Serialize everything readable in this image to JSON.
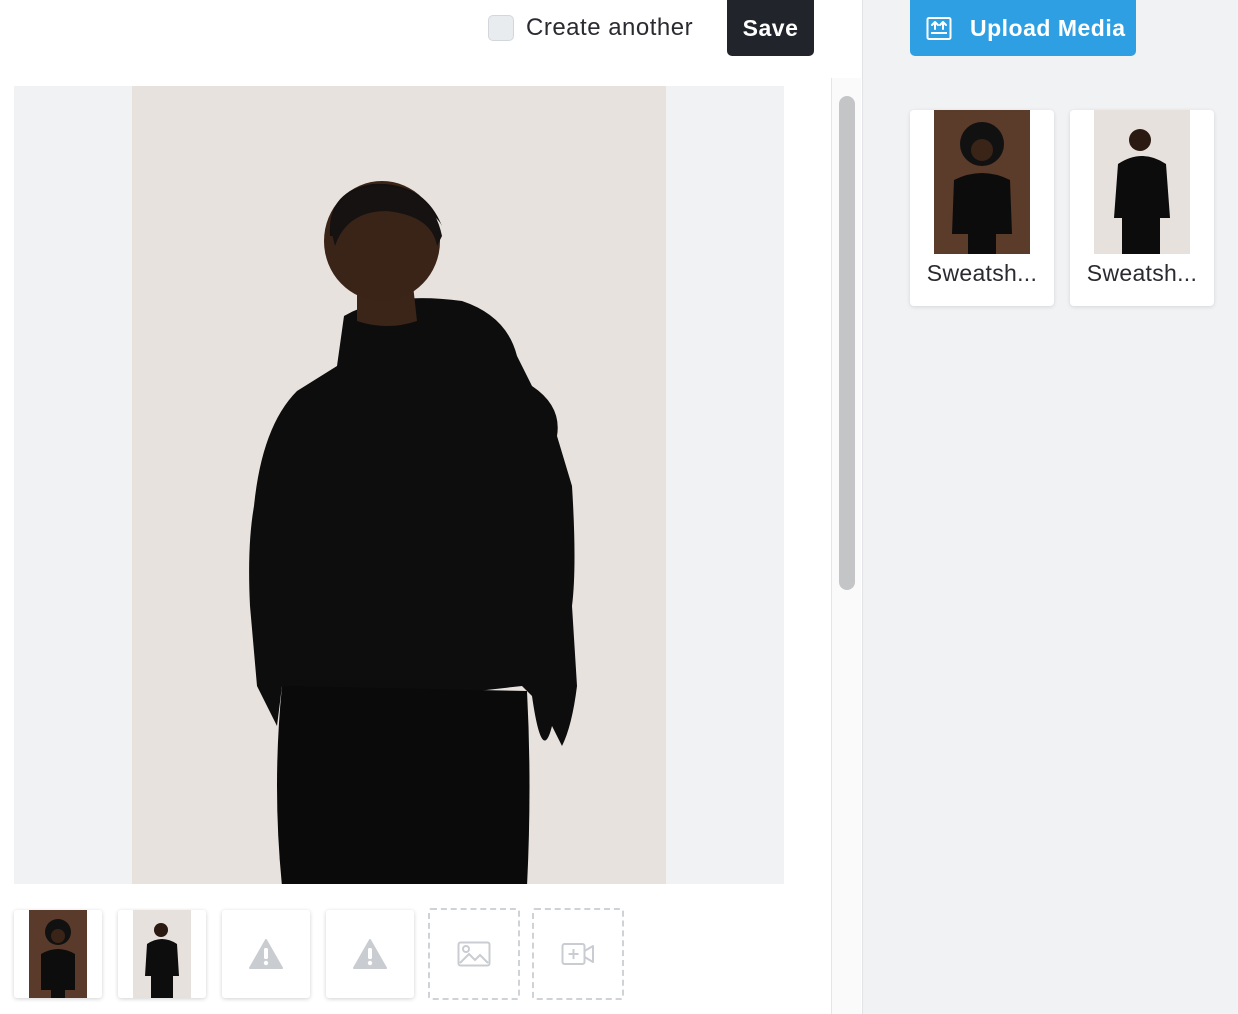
{
  "header": {
    "create_another_label": "Create another",
    "create_another_checked": false,
    "save_label": "Save"
  },
  "preview": {
    "selected_index": 1
  },
  "thumbnails": [
    {
      "kind": "image",
      "icon": "photo"
    },
    {
      "kind": "image",
      "icon": "photo"
    },
    {
      "kind": "error",
      "icon": "warning-icon"
    },
    {
      "kind": "error",
      "icon": "warning-icon"
    },
    {
      "kind": "placeholder",
      "icon": "add-image-icon"
    },
    {
      "kind": "placeholder",
      "icon": "add-video-icon"
    }
  ],
  "media_panel": {
    "upload_label": "Upload Media",
    "items": [
      {
        "name": "Sweatsh..."
      },
      {
        "name": "Sweatsh..."
      }
    ]
  },
  "colors": {
    "save_button": "#22242c",
    "upload_button": "#2f9fe3",
    "panel_background": "#f1f2f4",
    "warning_icon": "#c9ccd0"
  }
}
